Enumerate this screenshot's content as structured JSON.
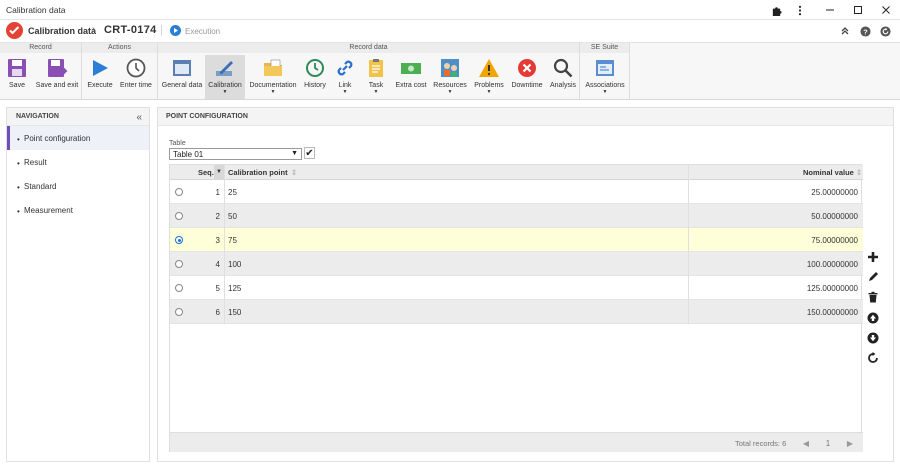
{
  "window": {
    "title": "Calibration data"
  },
  "header": {
    "breadcrumb": "Calibration data",
    "record_id": "CRT-0174",
    "status": "Execution"
  },
  "ribbon": {
    "groups": [
      {
        "title": "Record"
      },
      {
        "title": "Actions"
      },
      {
        "title": "Record data"
      },
      {
        "title": "SE Suite"
      }
    ],
    "buttons": [
      {
        "label": "Save",
        "icon": "save-icon"
      },
      {
        "label": "Save and exit",
        "icon": "save-exit-icon"
      },
      {
        "label": "Execute",
        "icon": "play-icon"
      },
      {
        "label": "Enter time",
        "icon": "clock-icon"
      },
      {
        "label": "General data",
        "icon": "window-icon"
      },
      {
        "label": "Calibration",
        "icon": "pencil-ruler-icon"
      },
      {
        "label": "Documentation",
        "icon": "folder-icon"
      },
      {
        "label": "History",
        "icon": "history-icon"
      },
      {
        "label": "Link",
        "icon": "link-icon"
      },
      {
        "label": "Task",
        "icon": "clipboard-icon"
      },
      {
        "label": "Extra cost",
        "icon": "money-icon"
      },
      {
        "label": "Resources",
        "icon": "people-icon"
      },
      {
        "label": "Problems",
        "icon": "warning-icon"
      },
      {
        "label": "Downtime",
        "icon": "stop-icon"
      },
      {
        "label": "Analysis",
        "icon": "magnifier-icon"
      },
      {
        "label": "Associations",
        "icon": "associations-icon"
      }
    ]
  },
  "navigation": {
    "title": "NAVIGATION",
    "items": [
      {
        "label": "Point configuration"
      },
      {
        "label": "Result"
      },
      {
        "label": "Standard"
      },
      {
        "label": "Measurement"
      }
    ]
  },
  "main": {
    "title": "POINT CONFIGURATION",
    "table_label": "Table",
    "table_value": "Table 01",
    "columns": {
      "seq": "Seq.",
      "point": "Calibration point",
      "nominal": "Nominal value"
    },
    "rows": [
      {
        "seq": "1",
        "point": "25",
        "nominal": "25.00000000"
      },
      {
        "seq": "2",
        "point": "50",
        "nominal": "50.00000000"
      },
      {
        "seq": "3",
        "point": "75",
        "nominal": "75.00000000"
      },
      {
        "seq": "4",
        "point": "100",
        "nominal": "100.00000000"
      },
      {
        "seq": "5",
        "point": "125",
        "nominal": "125.00000000"
      },
      {
        "seq": "6",
        "point": "150",
        "nominal": "150.00000000"
      }
    ],
    "total_records": "Total records: 6",
    "page": "1"
  },
  "colors": {
    "accent": "#6c4fb8",
    "selected_row": "#fefed9",
    "logo": "#e34234",
    "execute": "#2a7fd4"
  }
}
